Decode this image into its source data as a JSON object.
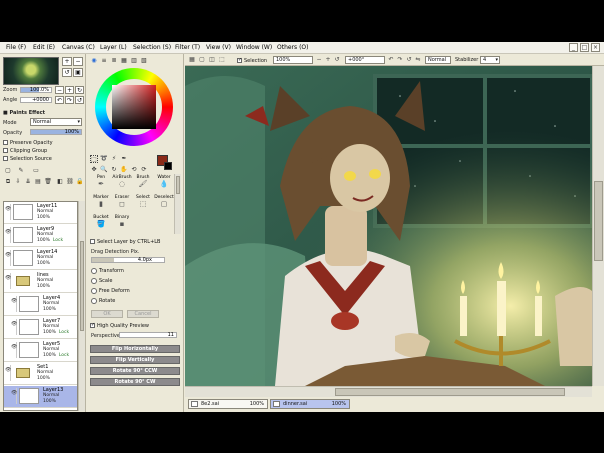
{
  "menubar": {
    "items": [
      "File (F)",
      "Edit (E)",
      "Canvas (C)",
      "Layer (L)",
      "Selection (S)",
      "Filter (T)",
      "View (V)",
      "Window (W)",
      "Others (O)"
    ],
    "window_controls": [
      "_",
      "□",
      "×"
    ]
  },
  "navigator": {
    "zoom_label": "Zoom",
    "zoom_value": "100.0%",
    "angle_label": "Angle",
    "angle_value": "+0000"
  },
  "paint_effect": {
    "title": "Paints Effect",
    "mode_label": "Mode",
    "mode_value": "Normal",
    "opacity_label": "Opacity",
    "opacity_value": "100%",
    "opacity_fraction": 1.0,
    "preserve_opacity": "Preserve Opacity",
    "clipping_group": "Clipping Group",
    "selection_source": "Selection Source"
  },
  "layers": [
    {
      "name": "Layer11",
      "mode": "Normal",
      "opacity": "100%",
      "lock": false,
      "indent": false,
      "folder": false,
      "selected": false
    },
    {
      "name": "Layer9",
      "mode": "Normal",
      "opacity": "100%",
      "lock": true,
      "indent": false,
      "folder": false,
      "selected": false
    },
    {
      "name": "Layer14",
      "mode": "Normal",
      "opacity": "100%",
      "lock": false,
      "indent": false,
      "folder": false,
      "selected": false
    },
    {
      "name": "lines",
      "mode": "Normal",
      "opacity": "100%",
      "lock": false,
      "indent": false,
      "folder": true,
      "selected": false
    },
    {
      "name": "Layer4",
      "mode": "Normal",
      "opacity": "100%",
      "lock": false,
      "indent": true,
      "folder": false,
      "selected": false
    },
    {
      "name": "Layer7",
      "mode": "Normal",
      "opacity": "100%",
      "lock": true,
      "indent": true,
      "folder": false,
      "selected": false
    },
    {
      "name": "Layer5",
      "mode": "Normal",
      "opacity": "100%",
      "lock": true,
      "indent": true,
      "folder": false,
      "selected": false
    },
    {
      "name": "Set1",
      "mode": "Normal",
      "opacity": "100%",
      "lock": false,
      "indent": false,
      "folder": true,
      "selected": false
    },
    {
      "name": "Layer13",
      "mode": "Normal",
      "opacity": "100%",
      "lock": false,
      "indent": true,
      "folder": false,
      "selected": true
    }
  ],
  "tools": {
    "brushes": [
      "Pen",
      "AirBrush",
      "Brush",
      "Water",
      "Marker",
      "Eraser",
      "Select",
      "Deselect",
      "Bucket",
      "Binary"
    ],
    "select_layer_ctrl": "Select Layer by CTRL+LB",
    "drag_detection_label": "Drag Detection Pix.",
    "drag_detection_value": "4.0px",
    "transform_options": [
      "Transform",
      "Scale",
      "Free Deform",
      "Rotate"
    ],
    "ok_label": "OK",
    "cancel_label": "Cancel",
    "high_quality_preview": "High Quality Preview",
    "perspective_label": "Perspective",
    "perspective_value": "11",
    "flip_horizontally": "Flip Horizontally",
    "flip_vertically": "Flip Vertically",
    "rotate_ccw": "Rotate 90° CCW",
    "rotate_cw": "Rotate 90° CW",
    "primary_color": "#8a2a18",
    "secondary_color": "#000000"
  },
  "canvas_toolbar": {
    "selection_label": "Selection",
    "zoom_value": "100%",
    "angle_value": "+000°",
    "blend_value": "Normal",
    "stabilizer_label": "Stabilizer",
    "stabilizer_value": "4"
  },
  "doc_tabs": [
    {
      "name": "8e2.sai",
      "zoom": "100%",
      "active": false
    },
    {
      "name": "dinner.sai",
      "zoom": "100%",
      "active": true
    }
  ]
}
